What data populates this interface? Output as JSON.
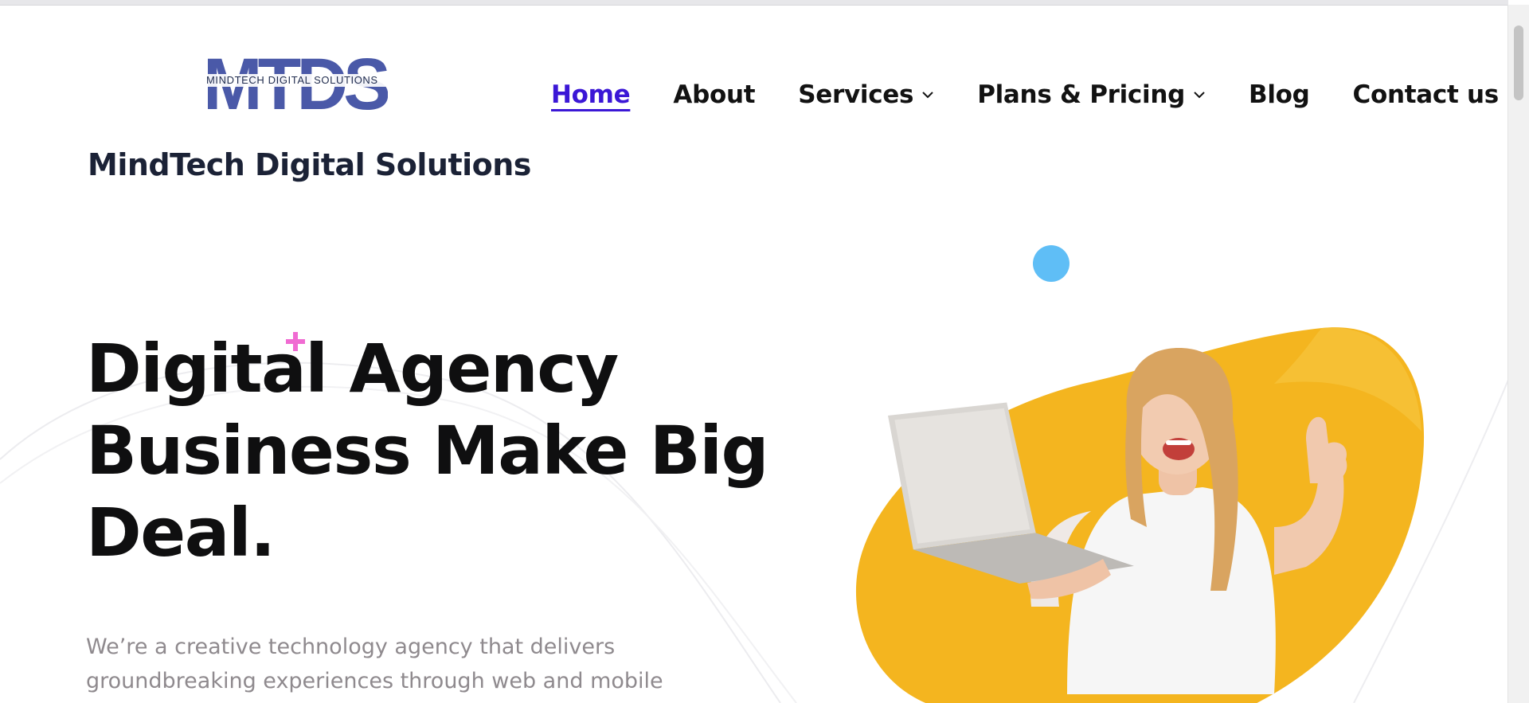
{
  "brand": {
    "logo_letters": "MTDS",
    "logo_caption": "MINDTECH DIGITAL SOLUTIONS",
    "name": "MindTech Digital Solutions"
  },
  "nav": {
    "items": [
      {
        "label": "Home",
        "active": true,
        "dropdown": false
      },
      {
        "label": "About",
        "active": false,
        "dropdown": false
      },
      {
        "label": "Services",
        "active": false,
        "dropdown": true
      },
      {
        "label": "Plans & Pricing",
        "active": false,
        "dropdown": true
      },
      {
        "label": "Blog",
        "active": false,
        "dropdown": false
      },
      {
        "label": "Contact us",
        "active": false,
        "dropdown": false
      }
    ]
  },
  "hero": {
    "title_lines": [
      "Digital Agency",
      "Business Make Big",
      "Deal."
    ],
    "description_lines": [
      "We’re a creative technology agency that delivers",
      "groundbreaking experiences through web and mobile"
    ]
  },
  "colors": {
    "accent_blue": "#3b17d6",
    "logo_blue": "#4a59a8",
    "blob_yellow": "#f4b51f",
    "dot_blue": "#5fbef6",
    "plus_pink": "#f06bd2"
  },
  "icons": {
    "nav_dropdown": "chevron-down-icon",
    "decoration_plus": "plus-icon",
    "decoration_dot": "circle-icon"
  }
}
